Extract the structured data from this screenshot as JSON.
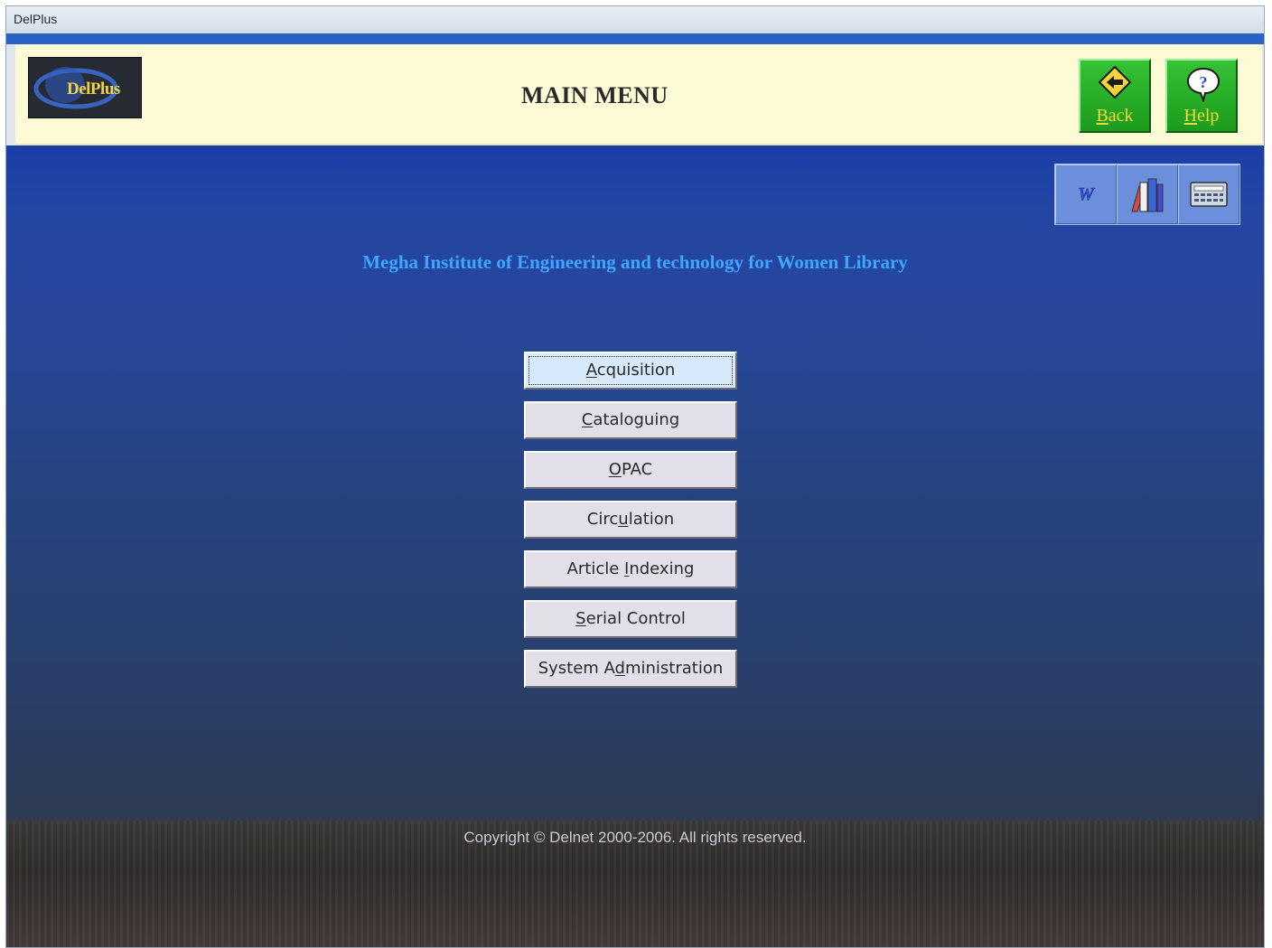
{
  "window": {
    "title": "DelPlus"
  },
  "header": {
    "logo_text": "DelPlus",
    "title": "MAIN MENU",
    "back": {
      "label_pre": "",
      "label_u": "B",
      "label_post": "ack",
      "icon": "back-arrow-icon"
    },
    "help": {
      "label_pre": "",
      "label_u": "H",
      "label_post": "elp",
      "icon": "help-icon"
    }
  },
  "toolbar": {
    "items": [
      {
        "icon": "word-icon",
        "glyph": "W"
      },
      {
        "icon": "books-icon"
      },
      {
        "icon": "calculator-icon"
      }
    ]
  },
  "institute": "Megha Institute of Engineering and technology for Women  Library",
  "menu": {
    "items": [
      {
        "pre": "",
        "u": "A",
        "post": "cquisition",
        "active": true
      },
      {
        "pre": "",
        "u": "C",
        "post": "ataloguing"
      },
      {
        "pre": "",
        "u": "O",
        "post": "PAC"
      },
      {
        "pre": "Circ",
        "u": "u",
        "post": "lation"
      },
      {
        "pre": "Article ",
        "u": "I",
        "post": "ndexing"
      },
      {
        "pre": "",
        "u": "S",
        "post": "erial Control"
      },
      {
        "pre": "System A",
        "u": "d",
        "post": "ministration"
      }
    ]
  },
  "footer": {
    "copyright": "Copyright © Delnet 2000-2006. All rights reserved."
  },
  "colors": {
    "header_bg": "#fdfbd6",
    "accent_green": "#1c9b1c",
    "institute_text": "#3fa6ff",
    "content_top": "#1a3ea8"
  }
}
